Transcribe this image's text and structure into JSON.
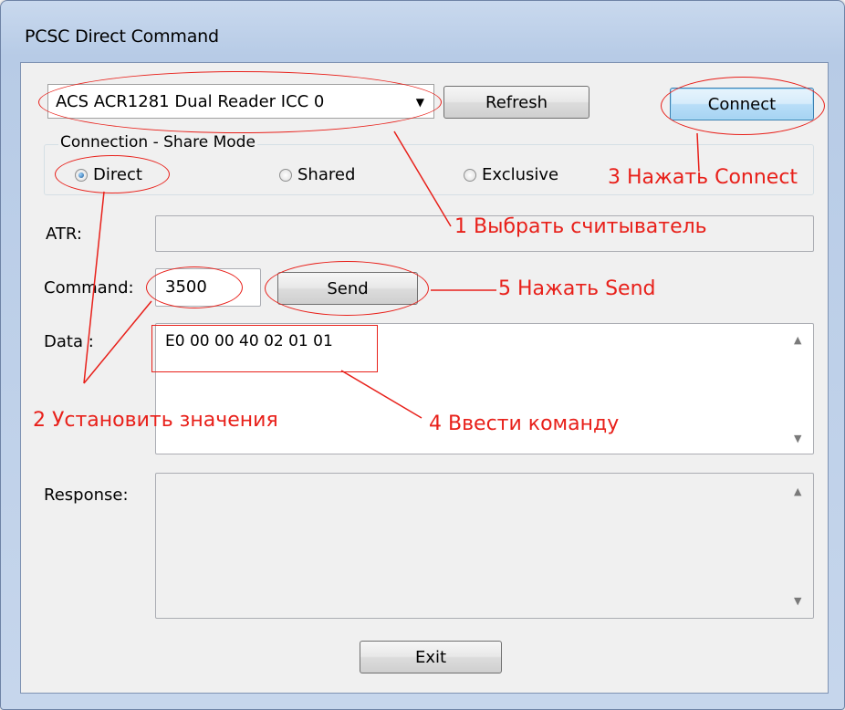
{
  "window": {
    "title": "PCSC Direct Command"
  },
  "reader": {
    "selected": "ACS ACR1281 Dual Reader ICC 0"
  },
  "buttons": {
    "refresh": "Refresh",
    "connect": "Connect",
    "send": "Send",
    "exit": "Exit"
  },
  "share_mode": {
    "title": "Connection - Share Mode",
    "options": [
      "Direct",
      "Shared",
      "Exclusive"
    ],
    "selected": "Direct"
  },
  "labels": {
    "atr": "ATR:",
    "command": "Command:",
    "data": "Data :",
    "response": "Response:"
  },
  "values": {
    "command": "3500",
    "data": "E0 00 00 40 02 01 01",
    "atr": "",
    "response": ""
  },
  "annotations": {
    "step1": "1 Выбрать считыватель",
    "step2": "2 Установить значения",
    "step3": "3 Нажать Connect",
    "step4": "4 Ввести команду",
    "step5": "5 Нажать Send"
  },
  "colors": {
    "annotation": "#e8201a",
    "default_button": "#a6d3f2",
    "window_frame": "#b7cbe6"
  },
  "icons": {
    "dropdown": "triangle-down-icon",
    "scroll_up": "scroll-up-arrow-icon",
    "scroll_down": "scroll-down-arrow-icon"
  }
}
